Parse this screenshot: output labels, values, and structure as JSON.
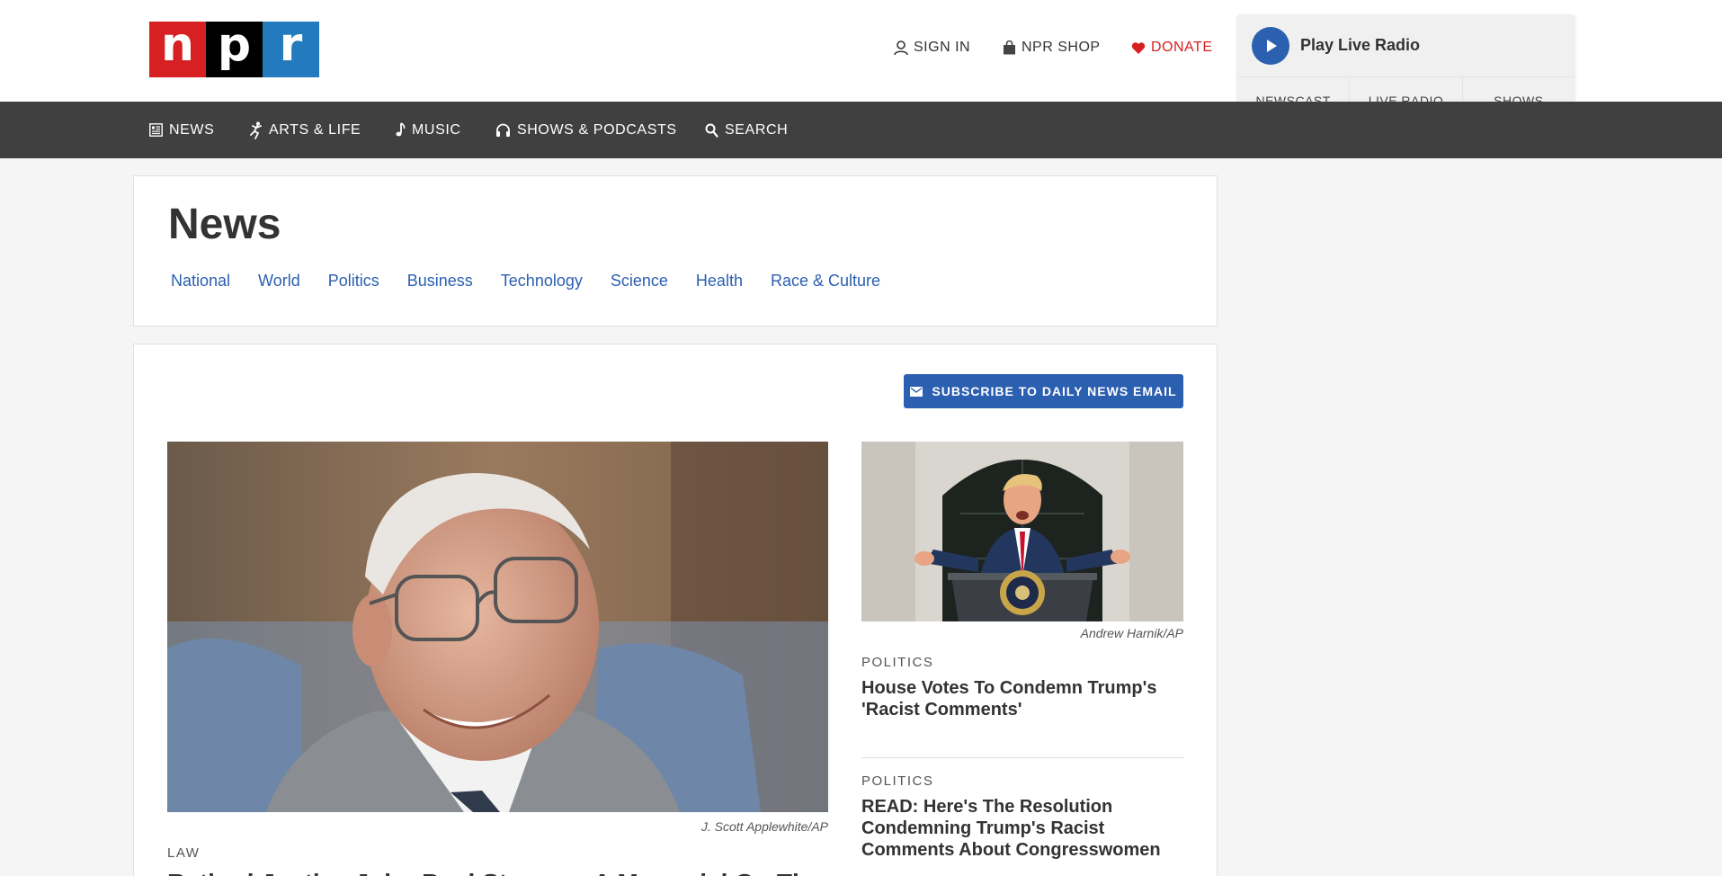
{
  "header": {
    "logo": [
      "n",
      "p",
      "r"
    ],
    "sign_in": "SIGN IN",
    "shop": "NPR SHOP",
    "donate": "DONATE"
  },
  "radio": {
    "play_label": "Play Live Radio",
    "tabs": [
      "NEWSCAST",
      "LIVE RADIO",
      "SHOWS"
    ]
  },
  "nav": {
    "items": [
      {
        "label": "NEWS",
        "icon": "news-icon"
      },
      {
        "label": "ARTS & LIFE",
        "icon": "arts-icon"
      },
      {
        "label": "MUSIC",
        "icon": "music-note-icon"
      },
      {
        "label": "SHOWS & PODCASTS",
        "icon": "headphones-icon"
      },
      {
        "label": "SEARCH",
        "icon": "search-icon"
      }
    ]
  },
  "section": {
    "title": "News",
    "subnav": [
      "National",
      "World",
      "Politics",
      "Business",
      "Technology",
      "Science",
      "Health",
      "Race & Culture"
    ]
  },
  "main": {
    "subscribe_label": "SUBSCRIBE TO DAILY NEWS EMAIL",
    "hero": {
      "credit": "J. Scott Applewhite/AP",
      "slug": "LAW",
      "headline": "Retired Justice John Paul Stevens: A Memorial On The"
    },
    "side_stories": [
      {
        "credit": "Andrew Harnik/AP",
        "slug": "POLITICS",
        "headline": "House Votes To Condemn Trump's 'Racist Comments'"
      },
      {
        "slug": "POLITICS",
        "headline": "READ: Here's The Resolution Condemning Trump's Racist Comments About Congresswomen"
      }
    ]
  },
  "colors": {
    "npr_red": "#d62021",
    "npr_blue": "#237bbd",
    "link_blue": "#2b5fb0",
    "nav_bg": "#404040"
  }
}
